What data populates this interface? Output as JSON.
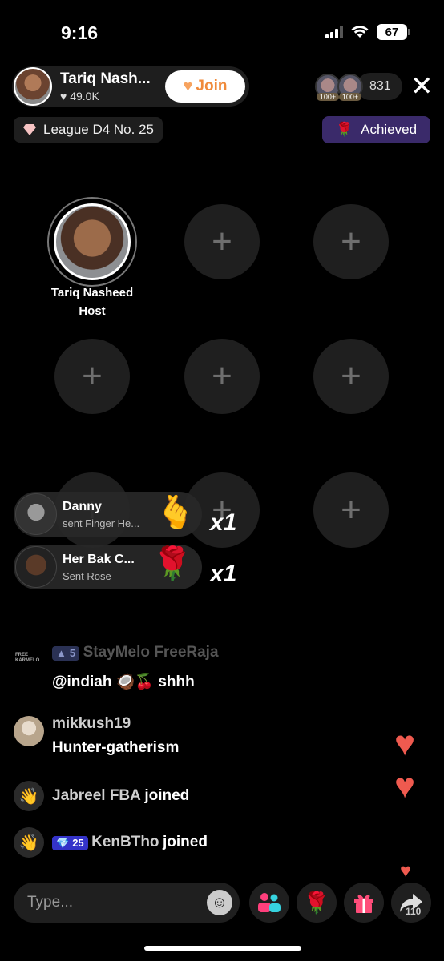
{
  "status": {
    "time": "9:16",
    "battery": "67"
  },
  "host": {
    "name": "Tariq Nash...",
    "likes": "49.0K",
    "join_label": "Join"
  },
  "viewers": {
    "badge1": "100+",
    "badge2": "100+",
    "count": "831"
  },
  "league": {
    "label": "League D4 No. 25"
  },
  "achieved": {
    "label": "Achieved"
  },
  "seat_host": {
    "name": "Tariq Nasheed",
    "role": "Host"
  },
  "seats_empty_icon": "+",
  "gifts": [
    {
      "name": "Danny",
      "sub": "sent Finger He...",
      "emoji": "🫰",
      "count": "x1"
    },
    {
      "name": "Her Bak C...",
      "sub": "Sent Rose",
      "emoji": "🌹",
      "count": "x1"
    }
  ],
  "chat": [
    {
      "logo": "FREE KARMELO.",
      "level": "5",
      "user": "StayMelo FreeRaja",
      "msg": "@indiah 🥥🍒 shhh"
    },
    {
      "user": "mikkush19",
      "msg": "Hunter-gatherism"
    },
    {
      "user": "Jabreel FBA",
      "msg": "joined"
    },
    {
      "level": "25",
      "user": "KenBTho",
      "msg": "joined"
    }
  ],
  "bottom": {
    "input_placeholder": "Type...",
    "share_count": "110"
  },
  "colors": {
    "accent": "#f08a3a",
    "achieved_bg": "#3a2a6a",
    "heart": "#ef5a4f"
  },
  "icons": [
    "signal-icon",
    "wifi-icon",
    "battery-icon",
    "heart-icon",
    "close-icon",
    "diamond-icon",
    "rose-icon",
    "plus-icon",
    "wave-icon",
    "emoji-icon",
    "guests-icon",
    "gift-icon",
    "share-icon"
  ]
}
